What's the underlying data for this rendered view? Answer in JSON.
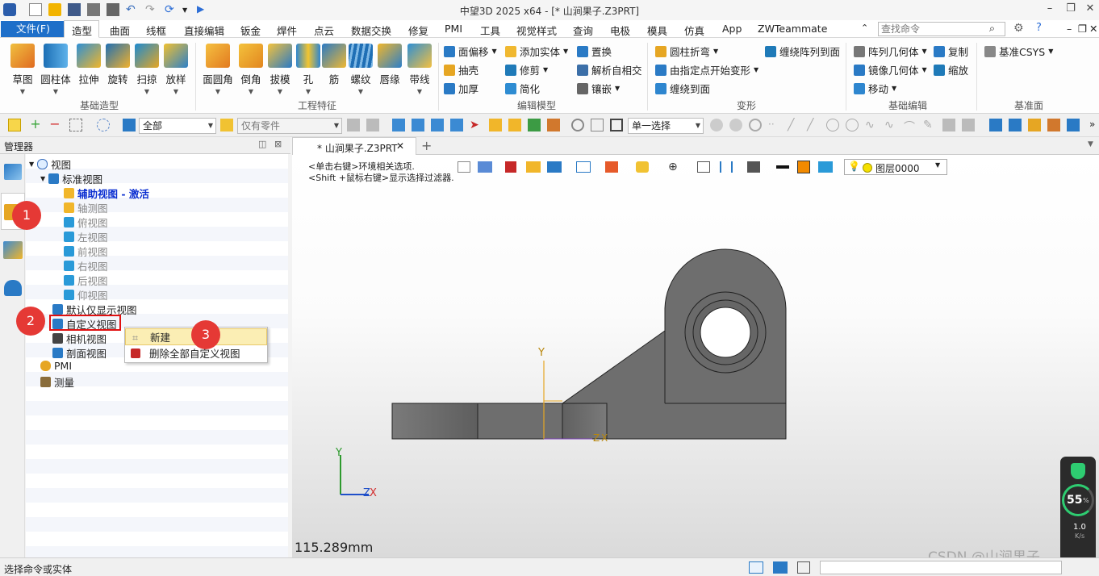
{
  "window": {
    "title": "中望3D 2025 x64 - [* 山涧果子.Z3PRT]"
  },
  "menu": {
    "file": "文件(F)",
    "tabs": [
      "造型",
      "曲面",
      "线框",
      "直接编辑",
      "钣金",
      "焊件",
      "点云",
      "数据交换",
      "修复",
      "PMI",
      "工具",
      "视觉样式",
      "查询",
      "电极",
      "模具",
      "仿真",
      "App",
      "ZWTeammate"
    ],
    "search_placeholder": "查找命令"
  },
  "ribbon": {
    "basic": {
      "label": "基础造型",
      "items": [
        "草图",
        "圆柱体",
        "拉伸",
        "旋转",
        "扫掠",
        "放样"
      ]
    },
    "features": {
      "label": "工程特征",
      "items": [
        "面圆角",
        "倒角",
        "拔模",
        "孔",
        "筋",
        "螺纹",
        "唇缘",
        "带线"
      ]
    },
    "edit": {
      "label": "编辑模型",
      "items": [
        "面偏移",
        "抽壳",
        "加厚",
        "添加实体",
        "修剪",
        "简化",
        "置换",
        "解析自相交",
        "镶嵌"
      ]
    },
    "deform": {
      "label": "变形",
      "items": [
        "圆柱折弯",
        "由指定点开始变形",
        "缠绕到面",
        "缠绕阵列到面"
      ]
    },
    "basicedit": {
      "label": "基础编辑",
      "items": [
        "阵列几何体",
        "镜像几何体",
        "移动",
        "复制",
        "缩放"
      ]
    },
    "datum": {
      "label": "基准面",
      "items": [
        "基准CSYS"
      ]
    }
  },
  "toolbar": {
    "filter": "全部",
    "parts": "仅有零件",
    "select_mode": "单一选择"
  },
  "manager": {
    "title": "管理器"
  },
  "tree": {
    "root": "视图",
    "std": "标准视图",
    "aux": "辅助视图 - 激活",
    "std_views": [
      "轴测图",
      "俯视图",
      "左视图",
      "前视图",
      "右视图",
      "后视图",
      "仰视图"
    ],
    "default_only": "默认仅显示视图",
    "custom": "自定义视图",
    "camera": "相机视图",
    "section": "剖面视图",
    "pmi": "PMI",
    "measure": "测量"
  },
  "context_menu": {
    "new": "新建",
    "delete_all": "删除全部自定义视图"
  },
  "doc": {
    "tab": "* 山涧果子.Z3PRT"
  },
  "viewport": {
    "hint1": "<单击右键>环境相关选项.",
    "hint2": "<Shift +鼠标右键>显示选择过滤器.",
    "layer": "图层0000",
    "scale": "115.289mm",
    "axis_y": "Y",
    "axis_z": "Z",
    "axis_x": "X",
    "colors": {
      "part": "#6e6e6e",
      "swatch": "#f28a00"
    }
  },
  "status": {
    "prompt": "选择命令或实体"
  },
  "badges": [
    "1",
    "2",
    "3"
  ],
  "widget": {
    "percent": "55",
    "pct_sign": "%",
    "speed": "1.0",
    "unit": "K/s"
  },
  "watermark": "CSDN @山涧果子"
}
